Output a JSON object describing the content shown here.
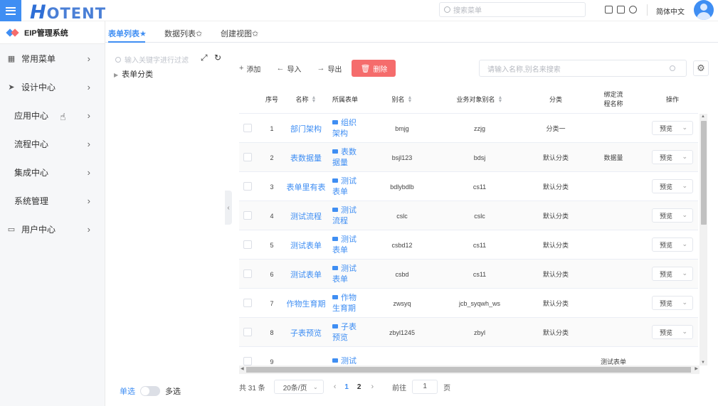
{
  "header": {
    "logo_text": "OTENT",
    "logo_initial": "H",
    "search_placeholder": "搜索菜单",
    "language": "简体中文",
    "icons": [
      "monitor-icon",
      "fullscreen-icon",
      "refresh-icon"
    ],
    "accent_color": "#3f8ef3"
  },
  "sidebar": {
    "system_title": "EIP管理系统",
    "items": [
      {
        "label": "常用菜单",
        "icon": "grid-icon"
      },
      {
        "label": "设计中心",
        "icon": "send-icon"
      },
      {
        "label": "应用中心",
        "icon": ""
      },
      {
        "label": "流程中心",
        "icon": ""
      },
      {
        "label": "集成中心",
        "icon": ""
      },
      {
        "label": "系统管理",
        "icon": ""
      },
      {
        "label": "用户中心",
        "icon": "monitor-icon"
      }
    ]
  },
  "tabs": [
    {
      "label": "表单列表★",
      "active": true
    },
    {
      "label": "数据列表✩",
      "active": false
    },
    {
      "label": "创建视图✩",
      "active": false
    }
  ],
  "tree": {
    "filter_placeholder": "输入关键字进行过滤",
    "root_label": "表单分类",
    "select_single": "单选",
    "select_multi": "多选"
  },
  "toolbar": {
    "add": "添加",
    "import": "导入",
    "export": "导出",
    "delete": "删除",
    "search_placeholder": "请输入名称,别名来搜索",
    "danger_color": "#f56c6c"
  },
  "table": {
    "columns": [
      "序号",
      "名称",
      "所属表单",
      "别名",
      "业务对象别名",
      "分类",
      "绑定流程名称",
      "操作"
    ],
    "rows": [
      {
        "no": "1",
        "name": "部门架构",
        "form": "组织架构",
        "alias": "bmjg",
        "bo_alias": "zzjg",
        "category": "分类一",
        "flow": "",
        "action": "预览"
      },
      {
        "no": "2",
        "name": "表数据量",
        "form": "表数据量",
        "alias": "bsjl123",
        "bo_alias": "bdsj",
        "category": "默认分类",
        "flow": "数据量",
        "action": "预览"
      },
      {
        "no": "3",
        "name": "表单里有表",
        "form": "测试表单",
        "alias": "bdlybdlb",
        "bo_alias": "cs11",
        "category": "默认分类",
        "flow": "",
        "action": "预览"
      },
      {
        "no": "4",
        "name": "测试流程",
        "form": "测试流程",
        "alias": "cslc",
        "bo_alias": "cslc",
        "category": "默认分类",
        "flow": "",
        "action": "预览"
      },
      {
        "no": "5",
        "name": "测试表单",
        "form": "测试表单",
        "alias": "csbd12",
        "bo_alias": "cs11",
        "category": "默认分类",
        "flow": "",
        "action": "预览"
      },
      {
        "no": "6",
        "name": "测试表单",
        "form": "测试表单",
        "alias": "csbd",
        "bo_alias": "cs11",
        "category": "默认分类",
        "flow": "",
        "action": "预览"
      },
      {
        "no": "7",
        "name": "作物生育期",
        "form": "作物生育期",
        "alias": "zwsyq",
        "bo_alias": "jcb_syqwh_ws",
        "category": "默认分类",
        "flow": "",
        "action": "预览"
      },
      {
        "no": "8",
        "name": "子表预览",
        "form": "子表预览",
        "alias": "zbyl1245",
        "bo_alias": "zbyl",
        "category": "默认分类",
        "flow": "",
        "action": "预览"
      },
      {
        "no": "9",
        "name": "",
        "form": "测试",
        "alias": "",
        "bo_alias": "",
        "category": "",
        "flow": "测试表单",
        "action": ""
      }
    ]
  },
  "pagination": {
    "total": "共 31 条",
    "page_size": "20条/页",
    "pages": [
      "1",
      "2"
    ],
    "current_page": "1",
    "goto_label": "前往",
    "goto_value": "1",
    "goto_suffix": "页"
  }
}
